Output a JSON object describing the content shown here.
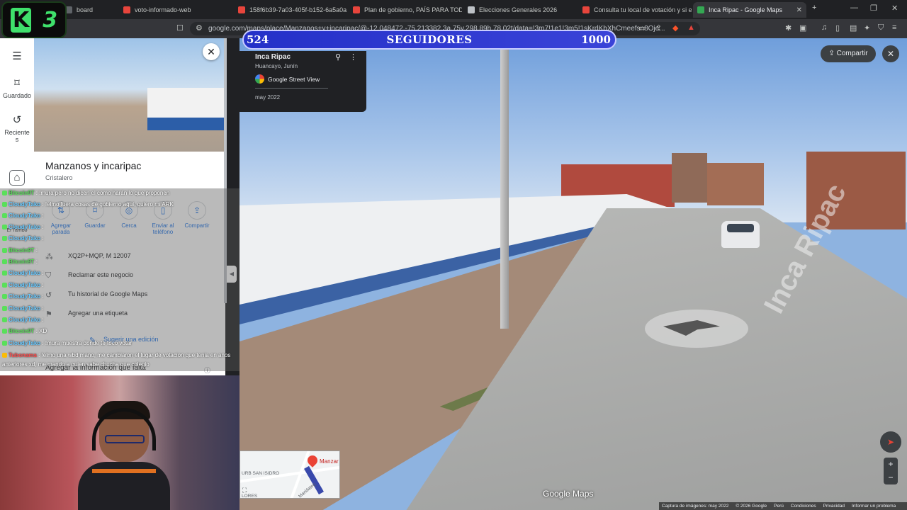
{
  "browser": {
    "tabs": [
      {
        "title": "board",
        "color": "#5f6368"
      },
      {
        "title": "voto-informado-web",
        "color": "#e8453c"
      },
      {
        "title": "158f6b39-7a03-405f-b152-6a5a0a",
        "color": "#e8453c"
      },
      {
        "title": "Plan de gobierno, PAÍS PARA TODOS",
        "color": "#e8453c"
      },
      {
        "title": "Elecciones Generales 2026",
        "color": "#bdc1c6"
      },
      {
        "title": "Consulta tu local de votación y si er",
        "color": "#e8453c"
      },
      {
        "title": "Inca Ripac - Google Maps",
        "color": "#34a853"
      }
    ],
    "new_tab": "+",
    "url": "google.com/maps/place/Manzanos+y+incaripac/@-12.048472,-75.213382,3a,75y,298.89h,78.02t/data=!3m7!1e1!3m5!1sKrdKbXhCmeefsn8Oje..."
  },
  "overlay": {
    "logo_k": "K",
    "logo_num": "3",
    "followers_current": "524",
    "followers_label": "SEGUIDORES",
    "followers_goal": "1000",
    "followers_progress": 0.524
  },
  "rail": {
    "guardado": "Guardado",
    "recientes": "Reciente\ns",
    "eltambo": "El Tambo"
  },
  "place": {
    "name": "Manzanos y incaripac",
    "category": "Cristalero",
    "actions": [
      "Agregar parada",
      "Guardar",
      "Cerca",
      "Enviar al teléfono",
      "Compartir"
    ],
    "plus_code": "XQ2P+MQP, M 12007",
    "call": "Reclamar este negocio",
    "history": "Tu historial de Google Maps",
    "label": "Agregar una etiqueta",
    "suggest": "Sugerir una edición",
    "missing": "Agregar la información que falta"
  },
  "chat": [
    {
      "user": "Bitcoin9T",
      "color": "#59e05a",
      "text": ": !mura pero no dicen el como harán lo que proponen"
    },
    {
      "user": "CloudyTako",
      "color": "#67c9ff",
      "text": ": !elmo fuera cosas de gobierno aquí, quiero mi ARK"
    },
    {
      "user": "CloudyTako",
      "color": "#67c9ff",
      "text": ":"
    },
    {
      "user": "CloudyTako",
      "color": "#67c9ff",
      "text": ":"
    },
    {
      "user": "CloudyTako",
      "color": "#67c9ff",
      "text": ":"
    },
    {
      "user": "Bitcoin9T",
      "color": "#59e05a",
      "text": ":"
    },
    {
      "user": "Bitcoin9T",
      "color": "#59e05a",
      "text": ":"
    },
    {
      "user": "CloudyTako",
      "color": "#67c9ff",
      "text": ":"
    },
    {
      "user": "CloudyTako",
      "color": "#67c9ff",
      "text": ":"
    },
    {
      "user": "CloudyTako",
      "color": "#67c9ff",
      "text": ":"
    },
    {
      "user": "CloudyTako",
      "color": "#67c9ff",
      "text": ":"
    },
    {
      "user": "CloudyTako",
      "color": "#67c9ff",
      "text": ":"
    },
    {
      "user": "Bitcoin9T",
      "color": "#59e05a",
      "text": ": XD"
    },
    {
      "user": "CloudyTako",
      "color": "#67c9ff",
      "text": ": !mura muestra donde te toco votar"
    },
    {
      "user": "Tubonama",
      "color": "#ff4d4d",
      "text": ": !elmo una wbd mano, me cambiaron el lugar de votacion que tenia en anos anteriores xd, me mando a quien sabe chucha que colegio"
    }
  ],
  "streetview": {
    "card_title": "Inca Ripac",
    "card_subtitle": "Huancayo, Junín",
    "card_source": "Google Street View",
    "card_date": "may 2022",
    "share": "Compartir",
    "road_name": "Inca Ripac",
    "logo": "Google Maps",
    "footer": [
      "Captura de imágenes: may 2022",
      "© 2026 Google",
      "Perú",
      "Condiciones",
      "Privacidad",
      "Informar un problema"
    ],
    "minimap_labels": [
      "URB SAN ISIDRO",
      "Manzar",
      "LORES",
      "Maridateg"
    ]
  }
}
